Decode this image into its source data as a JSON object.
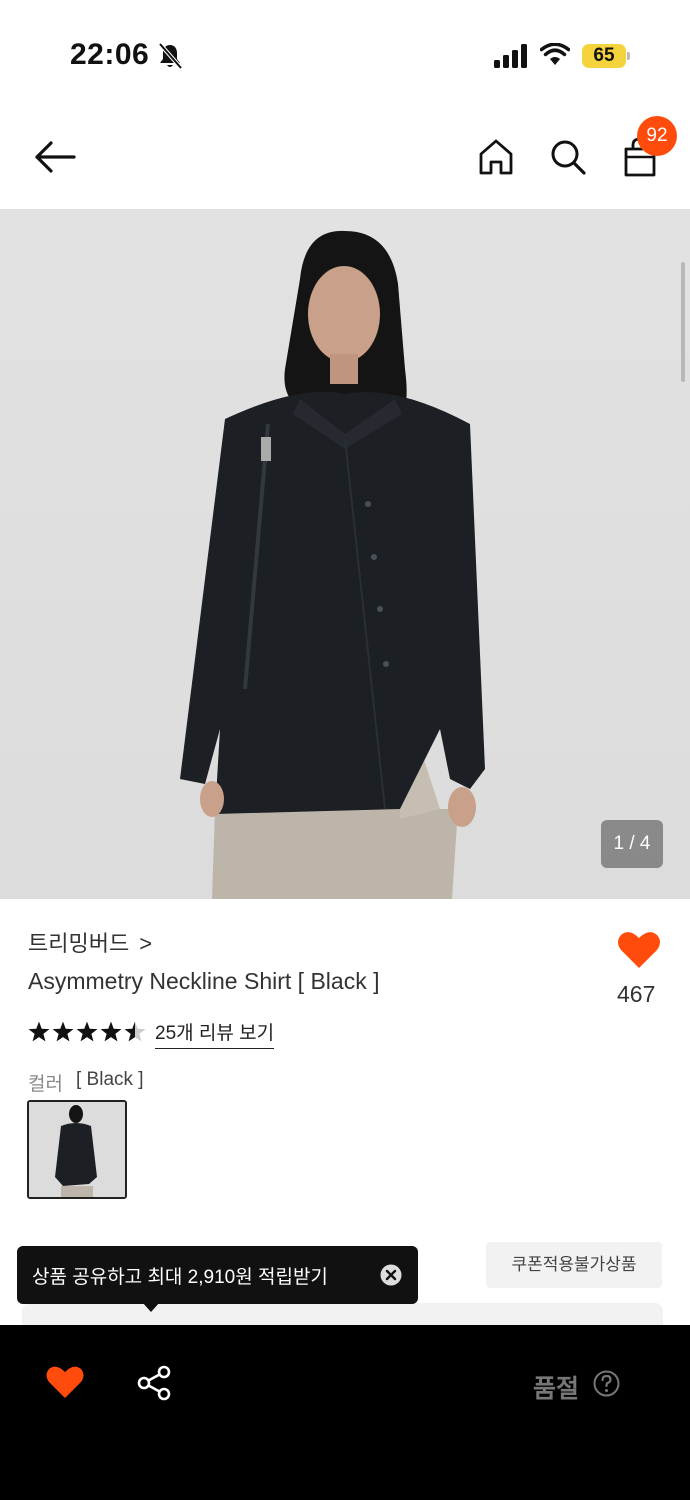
{
  "status_bar": {
    "time": "22:06",
    "battery": "65"
  },
  "header": {
    "cart_count": "92",
    "icons": [
      "back-arrow-icon",
      "home-icon",
      "search-icon",
      "shopping-bag-icon"
    ]
  },
  "gallery": {
    "counter": "1 / 4"
  },
  "product": {
    "brand": "트리밍버드",
    "brand_chevron": ">",
    "title": "Asymmetry Neckline Shirt [ Black ]",
    "likes": "467",
    "rating": 4.5,
    "review_link": "25개 리뷰 보기",
    "color_label": "컬러",
    "color_value": "[ Black ]",
    "coupon_note": "쿠폰적용불가상품"
  },
  "share_tooltip": {
    "text": "상품 공유하고 최대 2,910원 적립받기"
  },
  "bottom_bar": {
    "status": "품절"
  },
  "colors": {
    "accent": "#ff4c0c",
    "cart_badge": "#ff4c0c",
    "bottom_bar": "#000000",
    "battery": "#f4d33c"
  }
}
